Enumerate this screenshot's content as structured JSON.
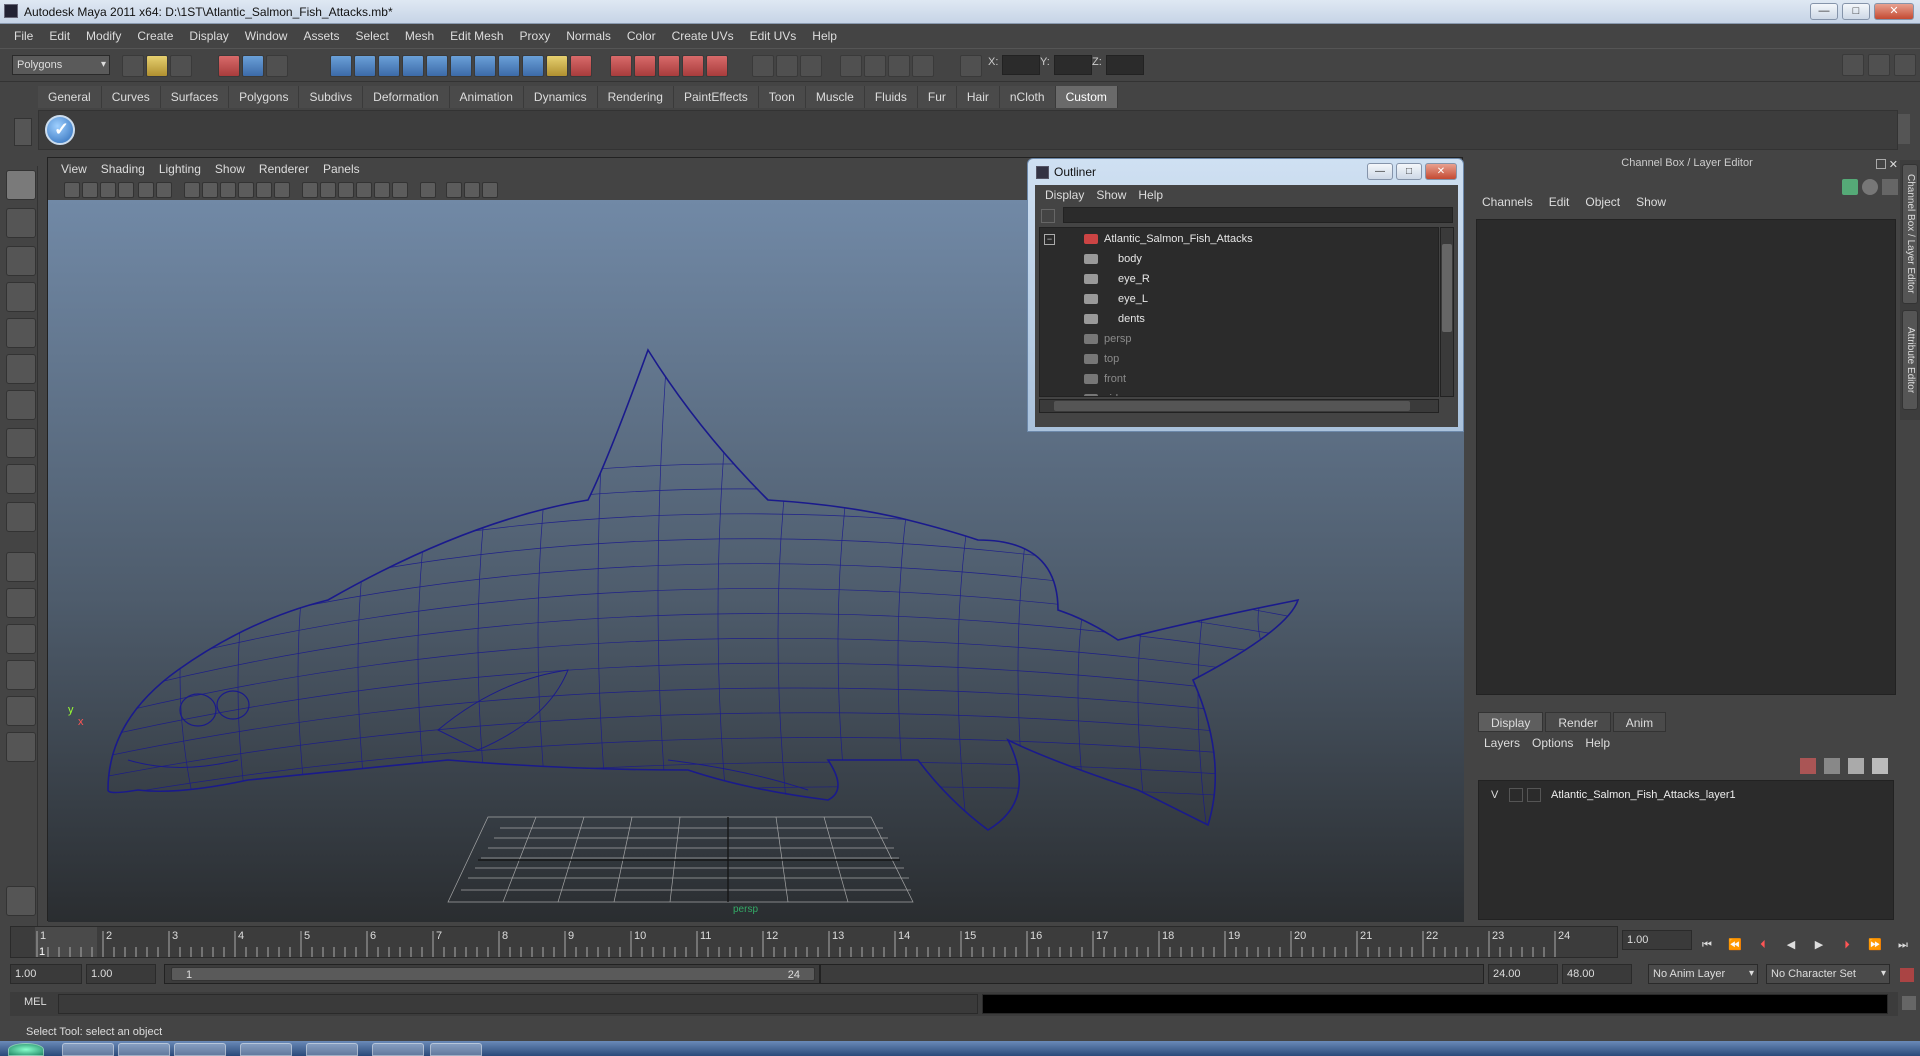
{
  "window": {
    "title": "Autodesk Maya 2011 x64: D:\\1ST\\Atlantic_Salmon_Fish_Attacks.mb*"
  },
  "menubar": [
    "File",
    "Edit",
    "Modify",
    "Create",
    "Display",
    "Window",
    "Assets",
    "Select",
    "Mesh",
    "Edit Mesh",
    "Proxy",
    "Normals",
    "Color",
    "Create UVs",
    "Edit UVs",
    "Help"
  ],
  "statusline": {
    "mode": "Polygons",
    "x_label": "X:",
    "y_label": "Y:",
    "z_label": "Z:"
  },
  "shelf_tabs": [
    "General",
    "Curves",
    "Surfaces",
    "Polygons",
    "Subdivs",
    "Deformation",
    "Animation",
    "Dynamics",
    "Rendering",
    "PaintEffects",
    "Toon",
    "Muscle",
    "Fluids",
    "Fur",
    "Hair",
    "nCloth",
    "Custom"
  ],
  "shelf_active": "Custom",
  "viewport": {
    "menu": [
      "View",
      "Shading",
      "Lighting",
      "Show",
      "Renderer",
      "Panels"
    ],
    "axis_y": "y",
    "axis_x": "x",
    "camera_label": "persp",
    "wire_color": "#1a1a8c"
  },
  "outliner": {
    "title": "Outliner",
    "menu": [
      "Display",
      "Show",
      "Help"
    ],
    "items": [
      {
        "label": "Atlantic_Salmon_Fish_Attacks",
        "level": 0,
        "dim": false
      },
      {
        "label": "body",
        "level": 1,
        "dim": false
      },
      {
        "label": "eye_R",
        "level": 1,
        "dim": false
      },
      {
        "label": "eye_L",
        "level": 1,
        "dim": false
      },
      {
        "label": "dents",
        "level": 1,
        "dim": false
      },
      {
        "label": "persp",
        "level": 0,
        "dim": true
      },
      {
        "label": "top",
        "level": 0,
        "dim": true
      },
      {
        "label": "front",
        "level": 0,
        "dim": true
      },
      {
        "label": "side",
        "level": 0,
        "dim": true
      }
    ]
  },
  "channel_box": {
    "title": "Channel Box / Layer Editor",
    "menu": [
      "Channels",
      "Edit",
      "Object",
      "Show"
    ],
    "side_tabs": [
      "Channel Box / Layer Editor",
      "Attribute Editor"
    ]
  },
  "layer_editor": {
    "tabs": [
      "Display",
      "Render",
      "Anim"
    ],
    "menu": [
      "Layers",
      "Options",
      "Help"
    ],
    "layer": {
      "visible": "V",
      "name": "Atlantic_Salmon_Fish_Attacks_layer1"
    }
  },
  "timeslider": {
    "ticks": [
      "1",
      "2",
      "3",
      "4",
      "5",
      "6",
      "7",
      "8",
      "9",
      "10",
      "11",
      "12",
      "13",
      "14",
      "15",
      "16",
      "17",
      "18",
      "19",
      "20",
      "21",
      "22",
      "23",
      "24"
    ],
    "current_frame": "1",
    "current_time": "1.00"
  },
  "range": {
    "start": "1.00",
    "playback_start": "1.00",
    "range_start": "1",
    "range_end": "24",
    "playback_end": "24.00",
    "end": "48.00",
    "anim_layer": "No Anim Layer",
    "character_set": "No Character Set"
  },
  "command": {
    "label": "MEL"
  },
  "helpline": {
    "text": "Select Tool: select an object"
  }
}
